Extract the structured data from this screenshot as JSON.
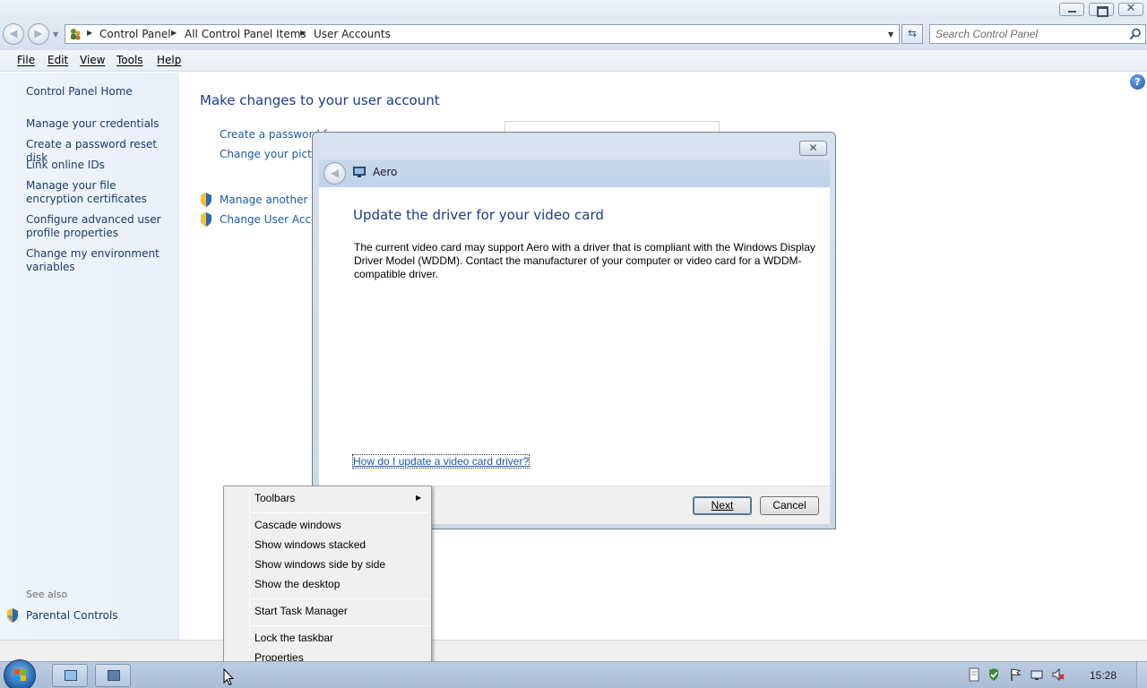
{
  "window": {
    "controls": {
      "close_glyph": "✕"
    }
  },
  "address": {
    "crumbs": [
      "Control Panel",
      "All Control Panel Items",
      "User Accounts"
    ],
    "search_placeholder": "Search Control Panel"
  },
  "menu": {
    "items": [
      "File",
      "Edit",
      "View",
      "Tools",
      "Help"
    ]
  },
  "left_nav": {
    "home": "Control Panel Home",
    "links": [
      "Manage your credentials",
      "Create a password reset disk",
      "Link online IDs",
      "Manage your file encryption certificates",
      "Configure advanced user profile properties",
      "Change my environment variables"
    ],
    "see_also": "See also",
    "parental_controls": "Parental Controls"
  },
  "main": {
    "title": "Make changes to your user account",
    "links": [
      "Create a password f",
      "Change your pictur",
      "Manage another ac",
      "Change User Accou"
    ],
    "help_glyph": "?"
  },
  "dialog": {
    "caption": "Aero",
    "heading": "Update the driver for your video card",
    "text": "The current video card may support Aero with a driver that is compliant with the Windows Display Driver Model (WDDM).  Contact the manufacturer of your computer or video card for a WDDM-compatible driver.",
    "link": "How do I update a video card driver?",
    "next": "Next",
    "cancel": "Cancel",
    "close_glyph": "✕"
  },
  "context_menu": {
    "items": [
      "Toolbars",
      "Cascade windows",
      "Show windows stacked",
      "Show windows side by side",
      "Show the desktop",
      "Start Task Manager",
      "Lock the taskbar",
      "Properties"
    ]
  },
  "taskbar": {
    "clock": "15:28"
  },
  "colors": {
    "link": "#1e5aa8",
    "heading": "#1e3a8a",
    "nav_link": "#1e3a6a",
    "taskbar": "#bccce0"
  },
  "icons": [
    "back-icon",
    "forward-icon",
    "refresh-icon",
    "search-icon",
    "help-icon",
    "uac-shield-icon",
    "windows-start-icon",
    "cursor-arrow-icon"
  ]
}
